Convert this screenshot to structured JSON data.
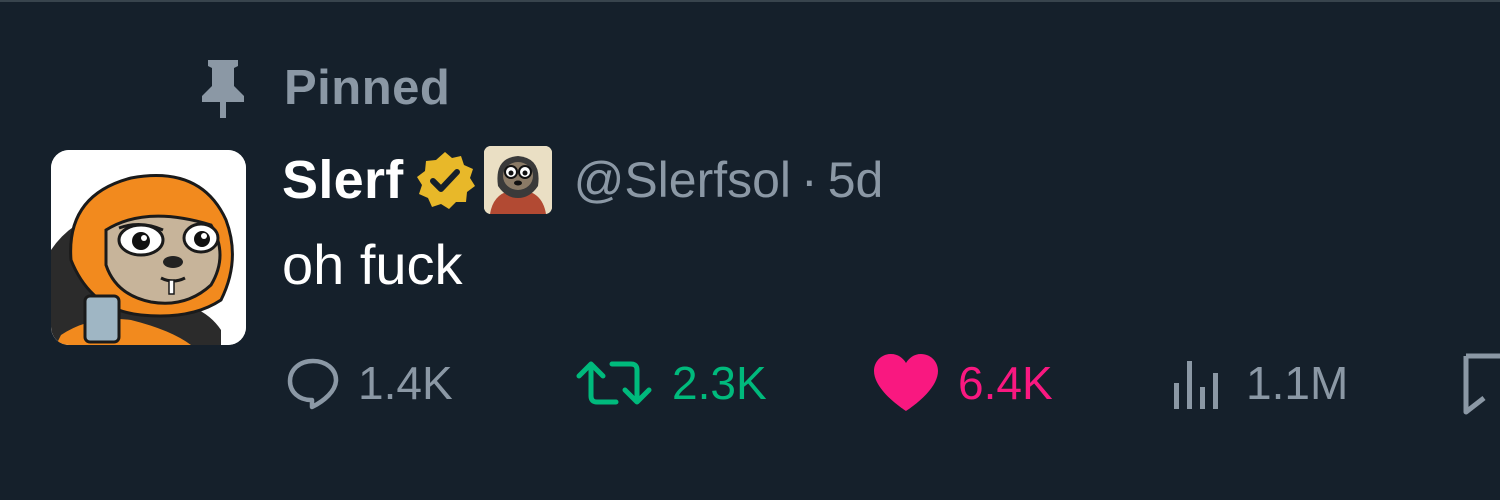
{
  "pinned": {
    "label": "Pinned",
    "icon": "pin-icon"
  },
  "author": {
    "display_name": "Slerf",
    "handle": "@Slerfsol",
    "separator": "·",
    "timestamp": "5d",
    "verified_color": "#e8b829"
  },
  "tweet": {
    "text": "oh fuck"
  },
  "actions": {
    "reply": {
      "count": "1.4K",
      "icon": "reply-icon"
    },
    "retweet": {
      "count": "2.3K",
      "icon": "retweet-icon",
      "color": "#00ba7c"
    },
    "like": {
      "count": "6.4K",
      "icon": "heart-icon",
      "color": "#f91880"
    },
    "views": {
      "count": "1.1M",
      "icon": "views-icon"
    },
    "bookmark": {
      "icon": "bookmark-icon"
    }
  },
  "theme": {
    "background": "#15202b",
    "text": "#ffffff",
    "muted": "#8b98a5"
  }
}
